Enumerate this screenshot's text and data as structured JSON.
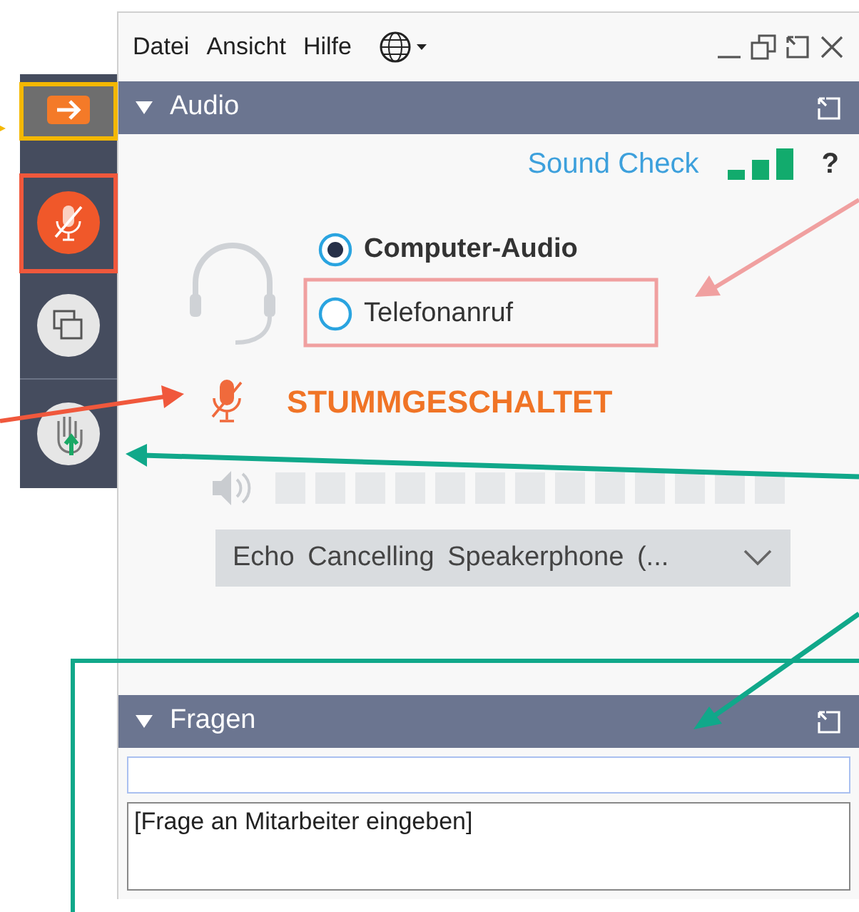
{
  "menu": [
    "Datei",
    "Ansicht",
    "Hilfe"
  ],
  "toolbar": [
    {
      "kind": "arrow"
    },
    {
      "kind": "mic"
    },
    {
      "kind": "screens"
    },
    {
      "kind": "hand"
    }
  ],
  "audio": {
    "title": "Audio",
    "expanded": true,
    "sound_check": "Sound Check",
    "help": "?",
    "options": [
      {
        "label": "Computer-Audio",
        "selected": true
      },
      {
        "label": "Telefonanruf",
        "selected": false
      }
    ],
    "muted": true,
    "status": "STUMMGESCHALTET",
    "device": "Echo Cancelling Speakerphone (..."
  },
  "questions": {
    "title": "Fragen",
    "expanded": true,
    "placeholder": "[Frage an Mitarbeiter eingeben]"
  }
}
